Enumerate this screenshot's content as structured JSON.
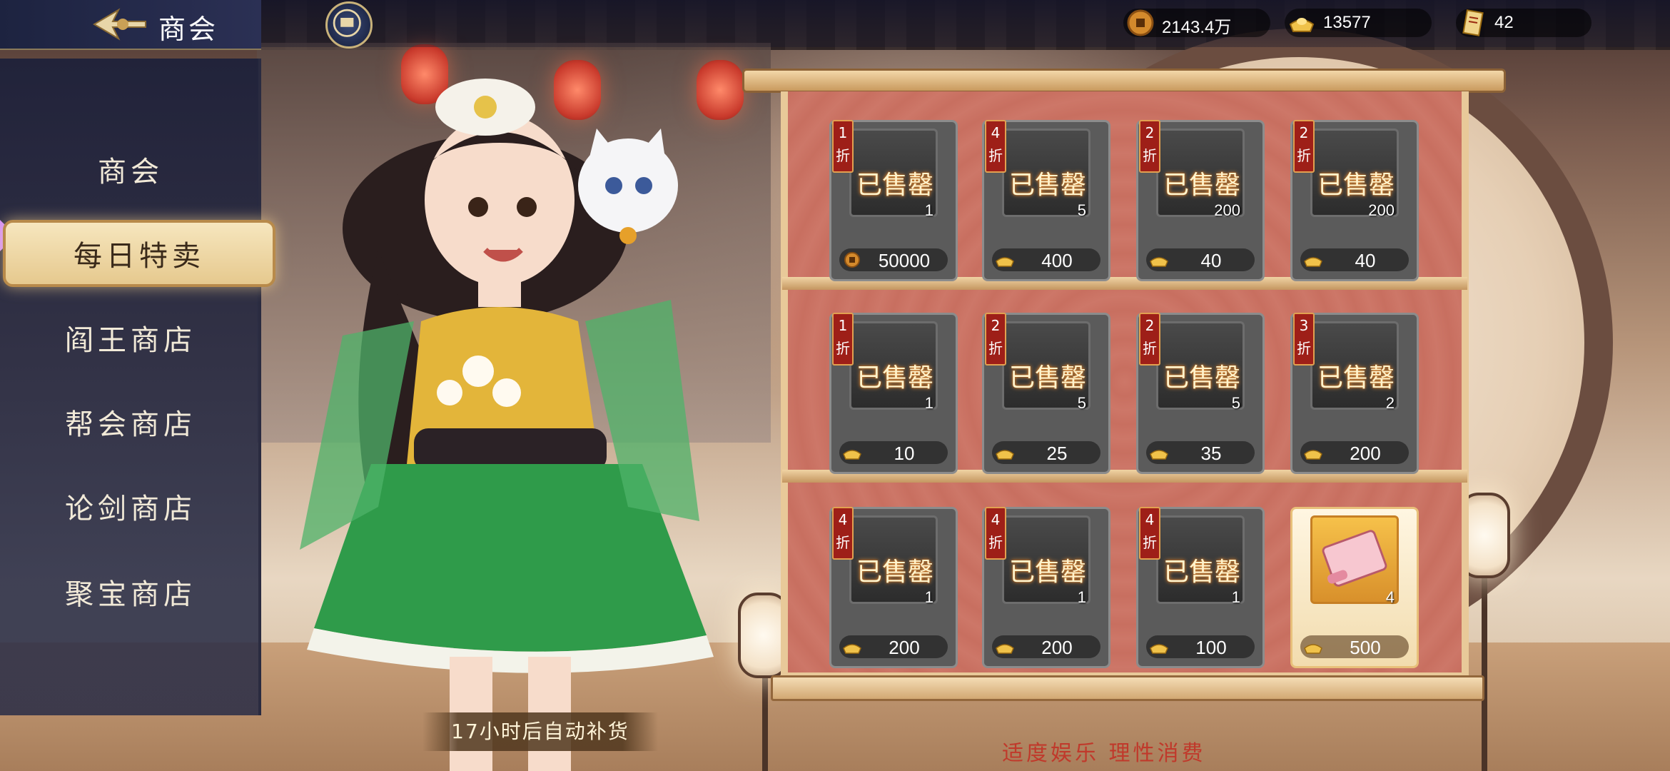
{
  "header": {
    "title": "商会",
    "back_icon": "back-arrow-icon",
    "currencies": [
      {
        "name": "copper-coin",
        "value": "2143.4万"
      },
      {
        "name": "gold-ingot",
        "value": "13577"
      },
      {
        "name": "scroll-ticket",
        "value": "42"
      }
    ]
  },
  "nav": {
    "items": [
      {
        "label": "商会",
        "active": false
      },
      {
        "label": "每日特卖",
        "active": true
      },
      {
        "label": "阎王商店",
        "active": false
      },
      {
        "label": "帮会商店",
        "active": false
      },
      {
        "label": "论剑商店",
        "active": false
      },
      {
        "label": "聚宝商店",
        "active": false
      }
    ]
  },
  "shop": {
    "sold_label": "已售罄",
    "discount_suffix": "折",
    "items": [
      {
        "discount": "1",
        "qty": "1",
        "price": "50000",
        "currency": "copper-coin",
        "sold": true
      },
      {
        "discount": "4",
        "qty": "5",
        "price": "400",
        "currency": "gold-ingot",
        "sold": true
      },
      {
        "discount": "2",
        "qty": "200",
        "price": "40",
        "currency": "gold-ingot",
        "sold": true
      },
      {
        "discount": "2",
        "qty": "200",
        "price": "40",
        "currency": "gold-ingot",
        "sold": true
      },
      {
        "discount": "1",
        "qty": "1",
        "price": "10",
        "currency": "gold-ingot",
        "sold": true
      },
      {
        "discount": "2",
        "qty": "5",
        "price": "25",
        "currency": "gold-ingot",
        "sold": true
      },
      {
        "discount": "2",
        "qty": "5",
        "price": "35",
        "currency": "gold-ingot",
        "sold": true
      },
      {
        "discount": "3",
        "qty": "2",
        "price": "200",
        "currency": "gold-ingot",
        "sold": true
      },
      {
        "discount": "4",
        "qty": "1",
        "price": "200",
        "currency": "gold-ingot",
        "sold": true
      },
      {
        "discount": "4",
        "qty": "1",
        "price": "200",
        "currency": "gold-ingot",
        "sold": true
      },
      {
        "discount": "4",
        "qty": "1",
        "price": "100",
        "currency": "gold-ingot",
        "sold": true
      },
      {
        "discount": "",
        "qty": "4",
        "price": "500",
        "currency": "gold-ingot",
        "sold": false
      }
    ]
  },
  "footer": {
    "restock_text": "17小时后自动补货",
    "advice_text": "适度娱乐 理性消费"
  },
  "colors": {
    "nav_active_bg": "#f6e6be",
    "discount_tag": "#9e1f18",
    "advice_text": "#c0392b",
    "shelf": "#cd7768"
  }
}
